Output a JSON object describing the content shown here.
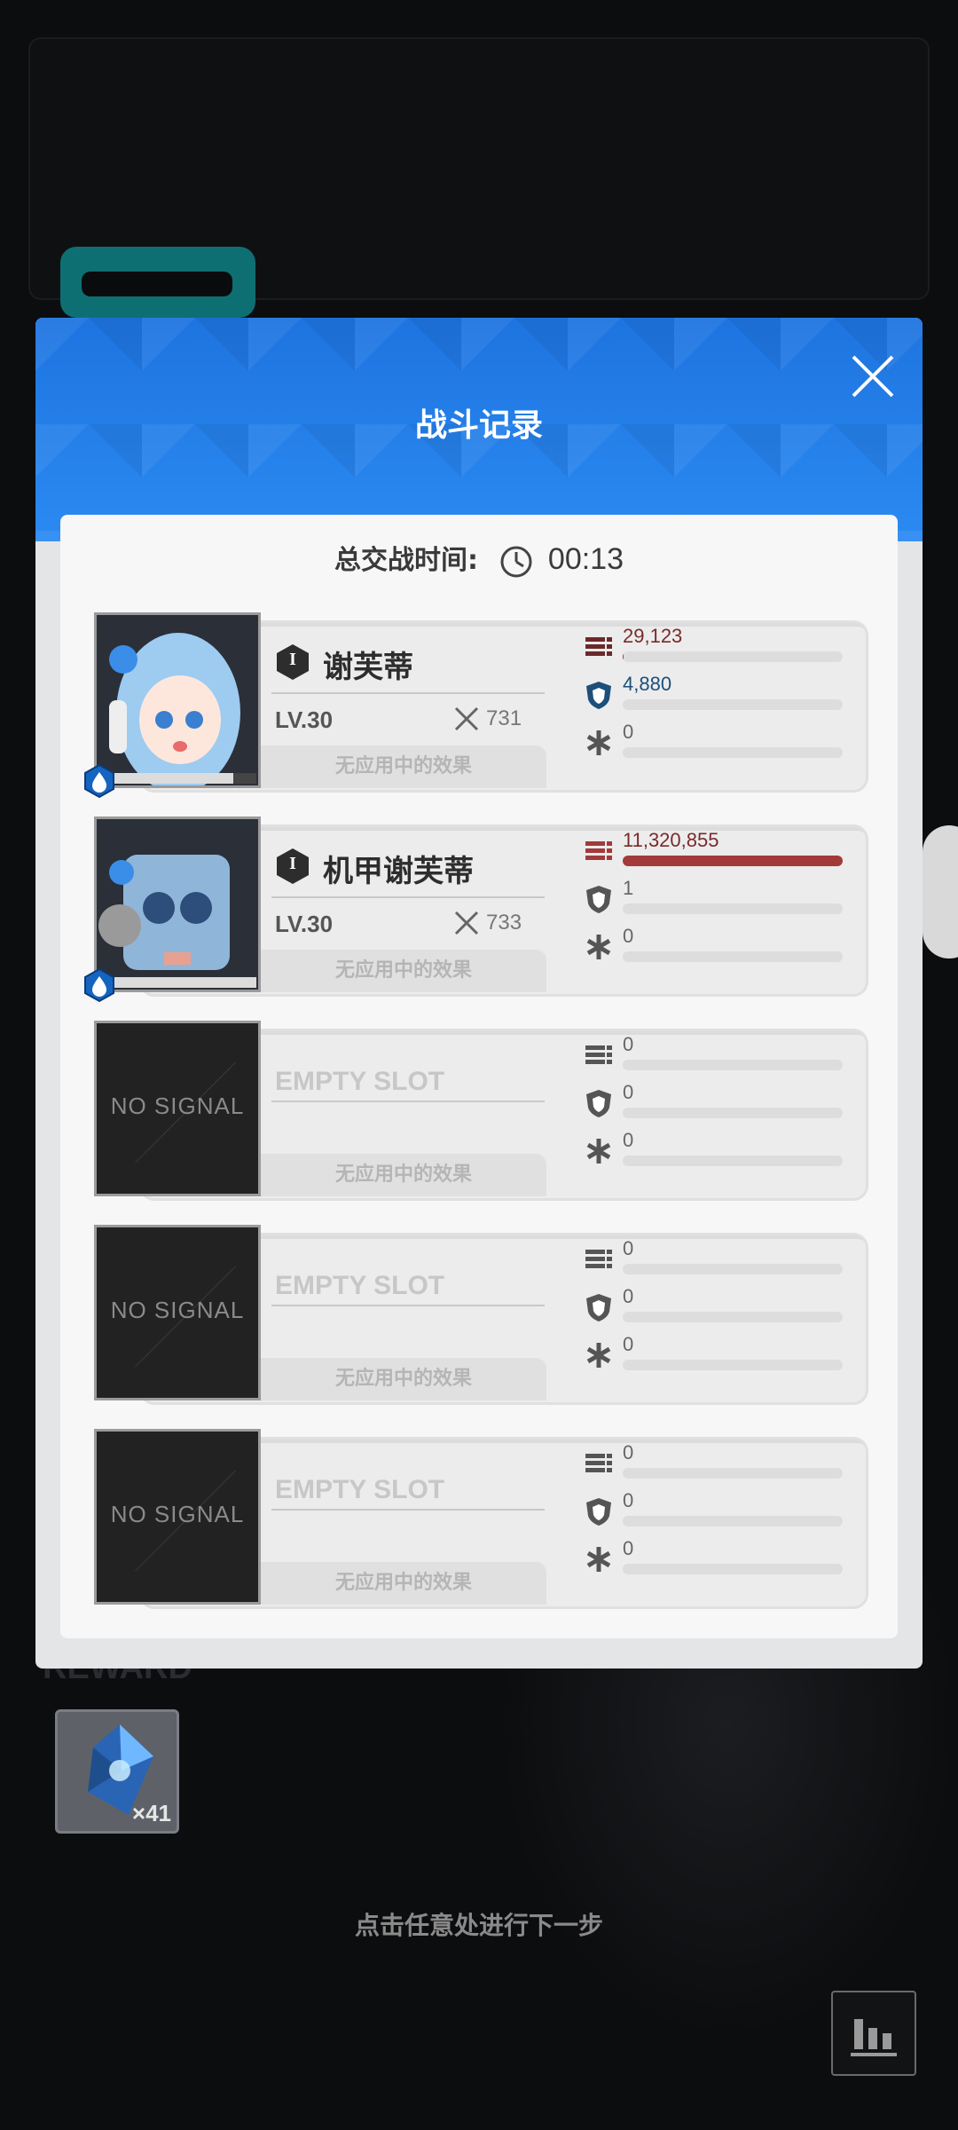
{
  "background": {
    "reward_label": "REWARD",
    "reward_item": {
      "icon": "crystal-icon",
      "count": "×41"
    },
    "hint": "点击任意处进行下一步"
  },
  "modal": {
    "title": "战斗记录",
    "battle_time_label": "总交战时间:",
    "battle_time_value": "00:13"
  },
  "squad": [
    {
      "type": "character",
      "name": "谢芙蒂",
      "rank": "I",
      "level": "LV.30",
      "power": "731",
      "effects": "无应用中的效果",
      "element": "water",
      "damage": "29,123",
      "damage_ratio": 0.003,
      "defense": "4,880",
      "defense_ratio": 0,
      "heal": "0",
      "heal_ratio": 0
    },
    {
      "type": "character",
      "name": "机甲谢芙蒂",
      "rank": "I",
      "level": "LV.30",
      "power": "733",
      "effects": "无应用中的效果",
      "element": "water",
      "damage": "11,320,855",
      "damage_ratio": 1.0,
      "defense": "1",
      "defense_ratio": 0,
      "heal": "0",
      "heal_ratio": 0
    },
    {
      "type": "empty",
      "name": "EMPTY SLOT",
      "portrait_text": "NO SIGNAL",
      "effects": "无应用中的效果",
      "damage": "0",
      "damage_ratio": 0,
      "defense": "0",
      "defense_ratio": 0,
      "heal": "0",
      "heal_ratio": 0
    },
    {
      "type": "empty",
      "name": "EMPTY SLOT",
      "portrait_text": "NO SIGNAL",
      "effects": "无应用中的效果",
      "damage": "0",
      "damage_ratio": 0,
      "defense": "0",
      "defense_ratio": 0,
      "heal": "0",
      "heal_ratio": 0
    },
    {
      "type": "empty",
      "name": "EMPTY SLOT",
      "portrait_text": "NO SIGNAL",
      "effects": "无应用中的效果",
      "damage": "0",
      "damage_ratio": 0,
      "defense": "0",
      "defense_ratio": 0,
      "heal": "0",
      "heal_ratio": 0
    }
  ],
  "colors": {
    "header_blue": "#2b8af2",
    "damage_bar": "#a33a3a",
    "element_water": "#1565c0"
  }
}
